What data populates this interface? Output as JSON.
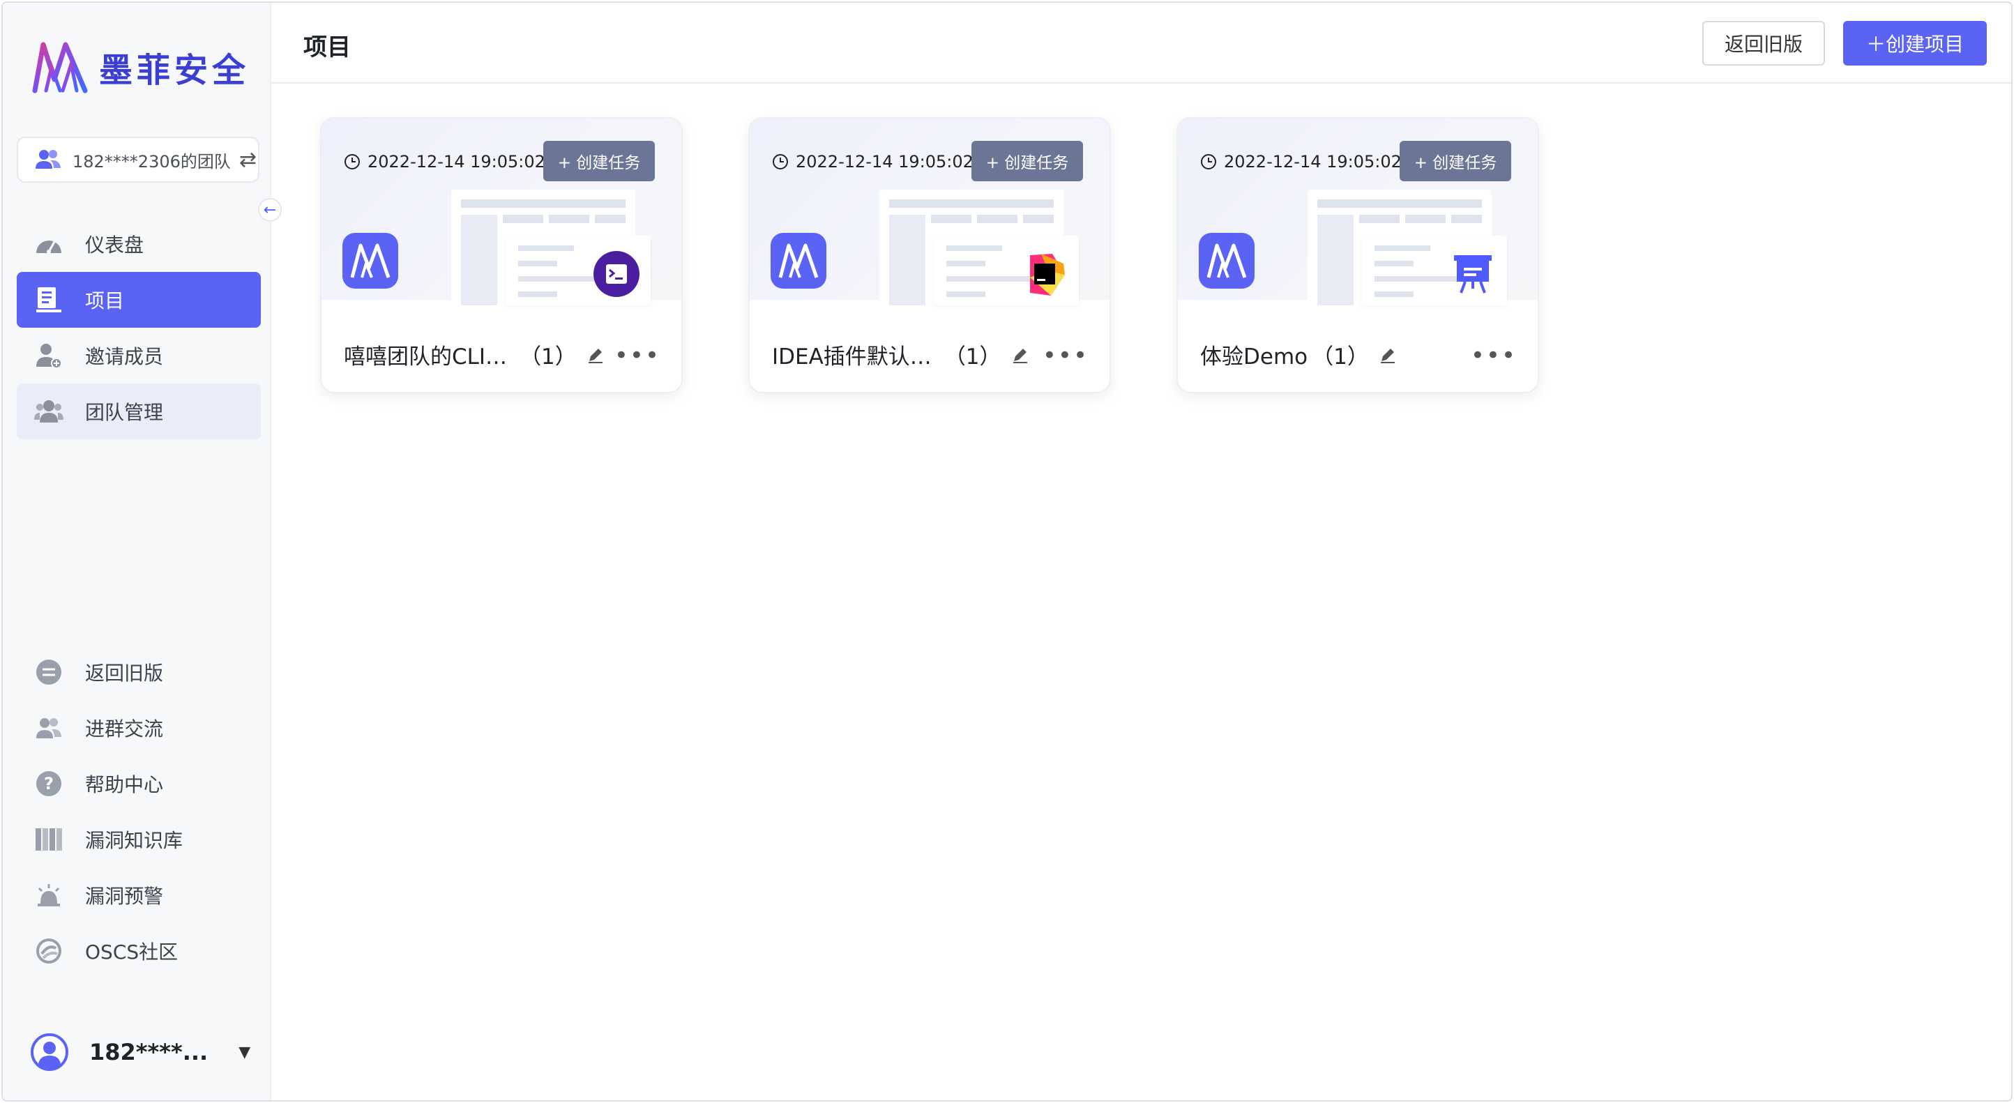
{
  "brand": {
    "name": "墨菲安全",
    "accent": "#5b63f5",
    "logo_color": "#3b3fd1"
  },
  "team": {
    "label": "182****2306的团队",
    "icon": "team-icon",
    "switch_icon": "swap-icon"
  },
  "sidebar": {
    "collapse_icon": "arrow-left-icon",
    "items": [
      {
        "label": "仪表盘",
        "icon": "dashboard-icon"
      },
      {
        "label": "项目",
        "icon": "project-icon"
      },
      {
        "label": "邀请成员",
        "icon": "invite-member-icon"
      },
      {
        "label": "团队管理",
        "icon": "team-manage-icon"
      }
    ],
    "bottom_items": [
      {
        "label": "返回旧版",
        "icon": "back-icon"
      },
      {
        "label": "进群交流",
        "icon": "group-icon"
      },
      {
        "label": "帮助中心",
        "icon": "help-icon"
      },
      {
        "label": "漏洞知识库",
        "icon": "library-icon"
      },
      {
        "label": "漏洞预警",
        "icon": "alarm-icon"
      },
      {
        "label": "OSCS社区",
        "icon": "community-icon"
      }
    ]
  },
  "user": {
    "name": "182****...",
    "caret_icon": "caret-down-icon"
  },
  "header": {
    "title": "项目",
    "back_old_label": "返回旧版",
    "create_project_label": "＋创建项目"
  },
  "projects": [
    {
      "time": "2022-12-14 19:05:02",
      "task_label": "+ 创建任务",
      "name": "嘻嘻团队的CLI…",
      "count": "（1）",
      "tool_icon": "cli-terminal-icon"
    },
    {
      "time": "2022-12-14 19:05:02",
      "task_label": "+ 创建任务",
      "name": "IDEA插件默认…",
      "count": "（1）",
      "tool_icon": "jetbrains-icon"
    },
    {
      "time": "2022-12-14 19:05:02",
      "task_label": "+ 创建任务",
      "name": "体验Demo",
      "count": "（1）",
      "tool_icon": "presentation-icon"
    }
  ]
}
